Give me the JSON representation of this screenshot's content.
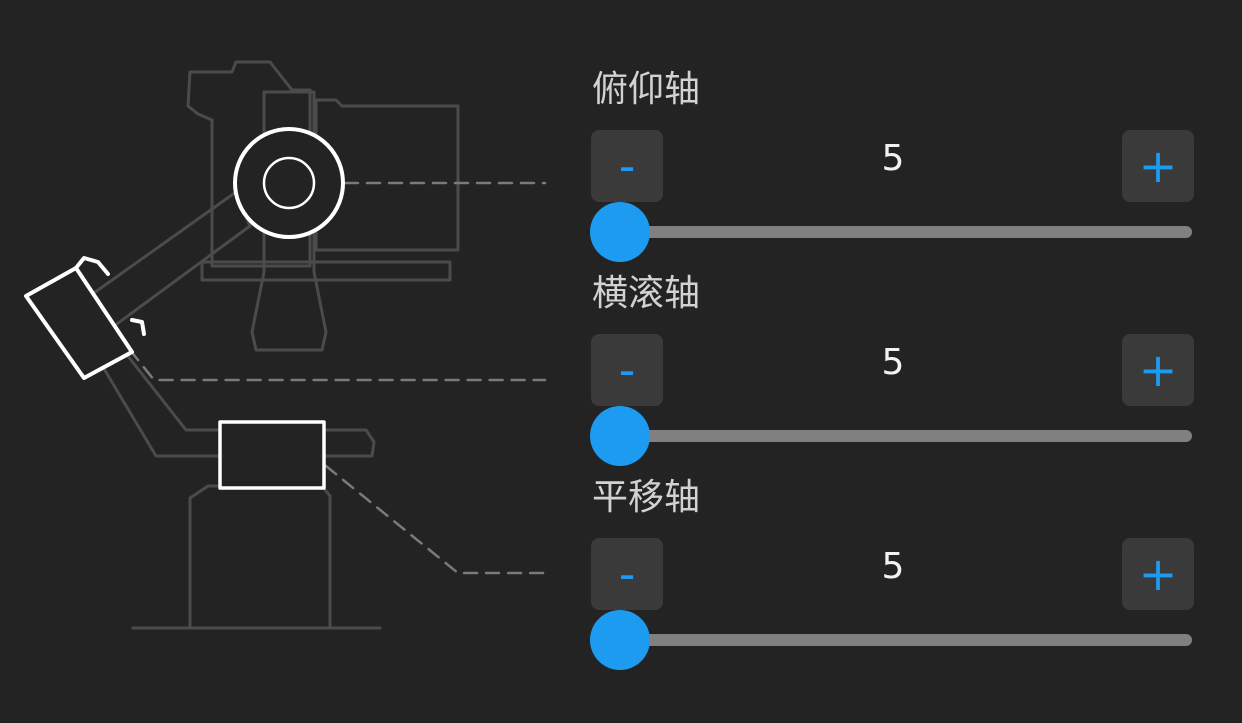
{
  "theme": {
    "accent": "#1d9bf0",
    "background": "#232323",
    "button_background": "#3a3a3a",
    "track": "#808080"
  },
  "axes": [
    {
      "id": "tilt",
      "title": "俯仰轴",
      "value": "5",
      "minus_label": "-",
      "plus_label": "+",
      "slider_fraction": 0
    },
    {
      "id": "roll",
      "title": "横滚轴",
      "value": "5",
      "minus_label": "-",
      "plus_label": "+",
      "slider_fraction": 0
    },
    {
      "id": "pan",
      "title": "平移轴",
      "value": "5",
      "minus_label": "-",
      "plus_label": "+",
      "slider_fraction": 0
    }
  ]
}
